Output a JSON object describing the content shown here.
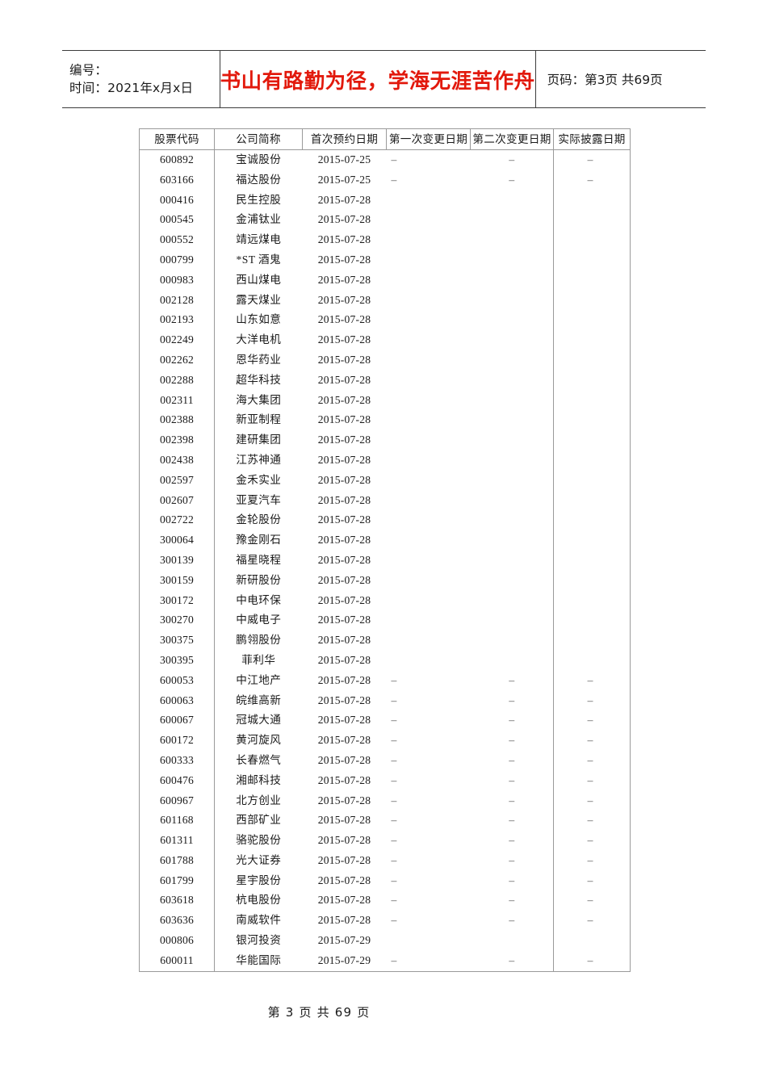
{
  "header": {
    "number_label": "编号：",
    "date_label": "时间：2021年x月x日",
    "slogan": "书山有路勤为径，学海无涯苦作舟",
    "page_info": "页码：第3页 共69页"
  },
  "table": {
    "columns": [
      "股票代码",
      "公司简称",
      "首次预约日期",
      "第一次变更日期",
      "第二次变更日期",
      "实际披露日期"
    ],
    "rows": [
      {
        "code": "600892",
        "name": "宝诚股份",
        "first": "2015-07-25",
        "change1": "–",
        "change2": "–",
        "actual": "–"
      },
      {
        "code": "603166",
        "name": "福达股份",
        "first": "2015-07-25",
        "change1": "–",
        "change2": "–",
        "actual": "–"
      },
      {
        "code": "000416",
        "name": "民生控股",
        "first": "2015-07-28",
        "change1": "",
        "change2": "",
        "actual": ""
      },
      {
        "code": "000545",
        "name": "金浦钛业",
        "first": "2015-07-28",
        "change1": "",
        "change2": "",
        "actual": ""
      },
      {
        "code": "000552",
        "name": "靖远煤电",
        "first": "2015-07-28",
        "change1": "",
        "change2": "",
        "actual": ""
      },
      {
        "code": "000799",
        "name": "*ST 酒鬼",
        "first": "2015-07-28",
        "change1": "",
        "change2": "",
        "actual": ""
      },
      {
        "code": "000983",
        "name": "西山煤电",
        "first": "2015-07-28",
        "change1": "",
        "change2": "",
        "actual": ""
      },
      {
        "code": "002128",
        "name": "露天煤业",
        "first": "2015-07-28",
        "change1": "",
        "change2": "",
        "actual": ""
      },
      {
        "code": "002193",
        "name": "山东如意",
        "first": "2015-07-28",
        "change1": "",
        "change2": "",
        "actual": ""
      },
      {
        "code": "002249",
        "name": "大洋电机",
        "first": "2015-07-28",
        "change1": "",
        "change2": "",
        "actual": ""
      },
      {
        "code": "002262",
        "name": "恩华药业",
        "first": "2015-07-28",
        "change1": "",
        "change2": "",
        "actual": ""
      },
      {
        "code": "002288",
        "name": "超华科技",
        "first": "2015-07-28",
        "change1": "",
        "change2": "",
        "actual": ""
      },
      {
        "code": "002311",
        "name": "海大集团",
        "first": "2015-07-28",
        "change1": "",
        "change2": "",
        "actual": ""
      },
      {
        "code": "002388",
        "name": "新亚制程",
        "first": "2015-07-28",
        "change1": "",
        "change2": "",
        "actual": ""
      },
      {
        "code": "002398",
        "name": "建研集团",
        "first": "2015-07-28",
        "change1": "",
        "change2": "",
        "actual": ""
      },
      {
        "code": "002438",
        "name": "江苏神通",
        "first": "2015-07-28",
        "change1": "",
        "change2": "",
        "actual": ""
      },
      {
        "code": "002597",
        "name": "金禾实业",
        "first": "2015-07-28",
        "change1": "",
        "change2": "",
        "actual": ""
      },
      {
        "code": "002607",
        "name": "亚夏汽车",
        "first": "2015-07-28",
        "change1": "",
        "change2": "",
        "actual": ""
      },
      {
        "code": "002722",
        "name": "金轮股份",
        "first": "2015-07-28",
        "change1": "",
        "change2": "",
        "actual": ""
      },
      {
        "code": "300064",
        "name": "豫金刚石",
        "first": "2015-07-28",
        "change1": "",
        "change2": "",
        "actual": ""
      },
      {
        "code": "300139",
        "name": "福星晓程",
        "first": "2015-07-28",
        "change1": "",
        "change2": "",
        "actual": ""
      },
      {
        "code": "300159",
        "name": "新研股份",
        "first": "2015-07-28",
        "change1": "",
        "change2": "",
        "actual": ""
      },
      {
        "code": "300172",
        "name": "中电环保",
        "first": "2015-07-28",
        "change1": "",
        "change2": "",
        "actual": ""
      },
      {
        "code": "300270",
        "name": "中威电子",
        "first": "2015-07-28",
        "change1": "",
        "change2": "",
        "actual": ""
      },
      {
        "code": "300375",
        "name": "鹏翎股份",
        "first": "2015-07-28",
        "change1": "",
        "change2": "",
        "actual": ""
      },
      {
        "code": "300395",
        "name": "菲利华",
        "first": "2015-07-28",
        "change1": "",
        "change2": "",
        "actual": ""
      },
      {
        "code": "600053",
        "name": "中江地产",
        "first": "2015-07-28",
        "change1": "–",
        "change2": "–",
        "actual": "–"
      },
      {
        "code": "600063",
        "name": "皖维高新",
        "first": "2015-07-28",
        "change1": "–",
        "change2": "–",
        "actual": "–"
      },
      {
        "code": "600067",
        "name": "冠城大通",
        "first": "2015-07-28",
        "change1": "–",
        "change2": "–",
        "actual": "–"
      },
      {
        "code": "600172",
        "name": "黄河旋风",
        "first": "2015-07-28",
        "change1": "–",
        "change2": "–",
        "actual": "–"
      },
      {
        "code": "600333",
        "name": "长春燃气",
        "first": "2015-07-28",
        "change1": "–",
        "change2": "–",
        "actual": "–"
      },
      {
        "code": "600476",
        "name": "湘邮科技",
        "first": "2015-07-28",
        "change1": "–",
        "change2": "–",
        "actual": "–"
      },
      {
        "code": "600967",
        "name": "北方创业",
        "first": "2015-07-28",
        "change1": "–",
        "change2": "–",
        "actual": "–"
      },
      {
        "code": "601168",
        "name": "西部矿业",
        "first": "2015-07-28",
        "change1": "–",
        "change2": "–",
        "actual": "–"
      },
      {
        "code": "601311",
        "name": "骆驼股份",
        "first": "2015-07-28",
        "change1": "–",
        "change2": "–",
        "actual": "–"
      },
      {
        "code": "601788",
        "name": "光大证券",
        "first": "2015-07-28",
        "change1": "–",
        "change2": "–",
        "actual": "–"
      },
      {
        "code": "601799",
        "name": "星宇股份",
        "first": "2015-07-28",
        "change1": "–",
        "change2": "–",
        "actual": "–"
      },
      {
        "code": "603618",
        "name": "杭电股份",
        "first": "2015-07-28",
        "change1": "–",
        "change2": "–",
        "actual": "–"
      },
      {
        "code": "603636",
        "name": "南威软件",
        "first": "2015-07-28",
        "change1": "–",
        "change2": "–",
        "actual": "–"
      },
      {
        "code": "000806",
        "name": "银河投资",
        "first": "2015-07-29",
        "change1": "",
        "change2": "",
        "actual": ""
      },
      {
        "code": "600011",
        "name": "华能国际",
        "first": "2015-07-29",
        "change1": "–",
        "change2": "–",
        "actual": "–"
      }
    ]
  },
  "footer": {
    "page_text": "第 3 页  共 69 页"
  }
}
